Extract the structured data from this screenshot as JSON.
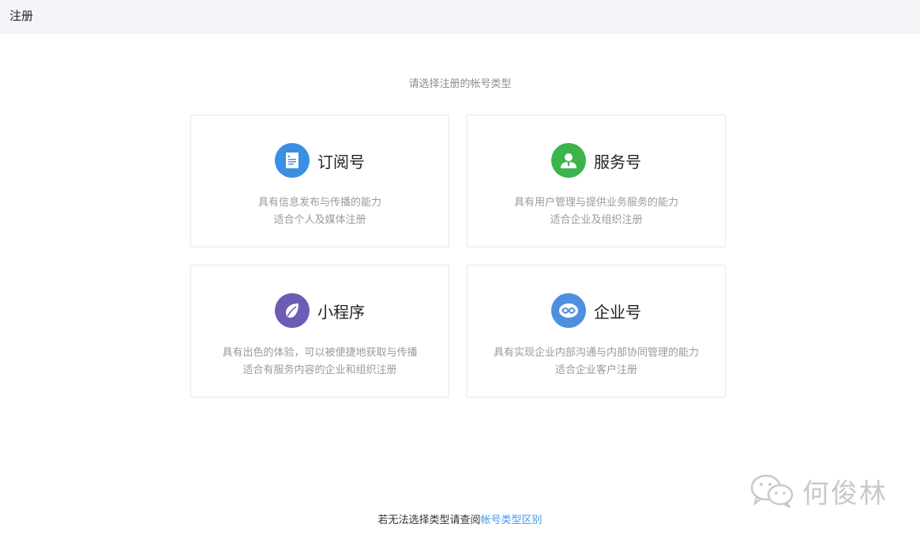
{
  "header": {
    "title": "注册"
  },
  "prompt": "请选择注册的帐号类型",
  "cards": [
    {
      "name": "订阅号",
      "icon": "document-icon",
      "icon_color": "#3a8fe3",
      "line1": "具有信息发布与传播的能力",
      "line2": "适合个人及媒体注册"
    },
    {
      "name": "服务号",
      "icon": "user-icon",
      "icon_color": "#3cb44b",
      "line1": "具有用户管理与提供业务服务的能力",
      "line2": "适合企业及组织注册"
    },
    {
      "name": "小程序",
      "icon": "leaf-icon",
      "icon_color": "#6d5bb5",
      "line1": "具有出色的体验，可以被便捷地获取与传播",
      "line2": "适合有服务内容的企业和组织注册"
    },
    {
      "name": "企业号",
      "icon": "chat-link-icon",
      "icon_color": "#4f8fe0",
      "line1": "具有实现企业内部沟通与内部协同管理的能力",
      "line2": "适合企业客户注册"
    }
  ],
  "footer": {
    "text": "若无法选择类型请查阅",
    "link": "帐号类型区别"
  },
  "watermark": {
    "text": "何俊林",
    "icon": "wechat-icon"
  }
}
